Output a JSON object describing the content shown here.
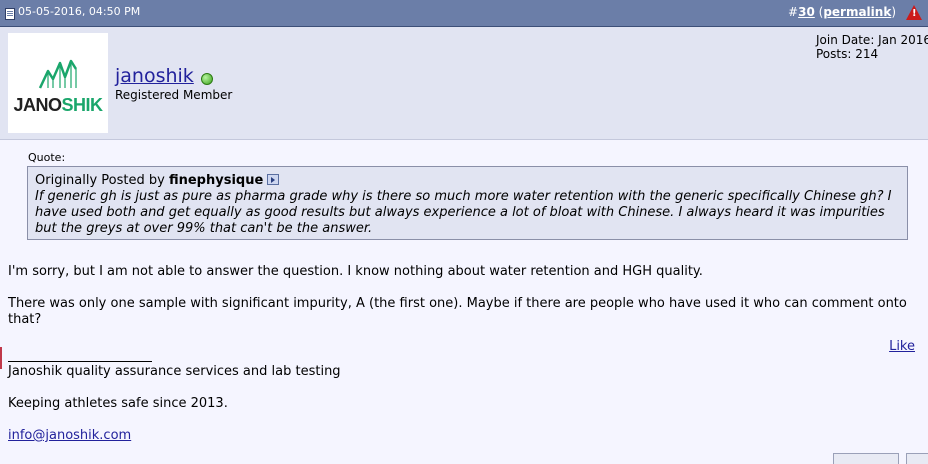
{
  "post_header": {
    "date": "05-05-2016, 04:50 PM",
    "post_number_prefix": "#",
    "post_number": "30",
    "permalink_open": " (",
    "permalink_label": "permalink",
    "permalink_close": ")",
    "report_icon": "warning-triangle-icon"
  },
  "user": {
    "avatar_logo_a": "JANO",
    "avatar_logo_b": "SHIK",
    "username": "janoshik",
    "status_icon": "online-status-icon",
    "title": "Registered Member",
    "join_date_line": "Join Date: Jan 2016",
    "posts_line": "Posts: 214"
  },
  "quote": {
    "label": "Quote:",
    "originally_posted_by": "Originally Posted by ",
    "author": "finephysique",
    "view_post_icon": "view-post-icon",
    "text": "If generic gh is just as pure as pharma grade why is there so much more water retention with the generic specifically Chinese gh? I have used both and get equally as good results but always experience a lot of bloat with Chinese. I always heard it was impurities but the greys at over 99% that can't be the answer."
  },
  "body": {
    "para1": "I'm sorry, but I am not able to answer the question. I know nothing about water retention and HGH quality.",
    "para2": "There was only one sample with significant impurity, A (the first one). Maybe if there are people who have used it who can comment onto that?"
  },
  "like_label": "Like",
  "signature": {
    "line1": "Janoshik quality assurance services and lab testing",
    "line2": "Keeping athletes safe since 2013.",
    "email": "info@janoshik.com"
  },
  "colors": {
    "header_bg": "#6b7ea8",
    "userbar_bg": "#e1e4f2",
    "link": "#22229c",
    "logo_green": "#1aa66b"
  }
}
